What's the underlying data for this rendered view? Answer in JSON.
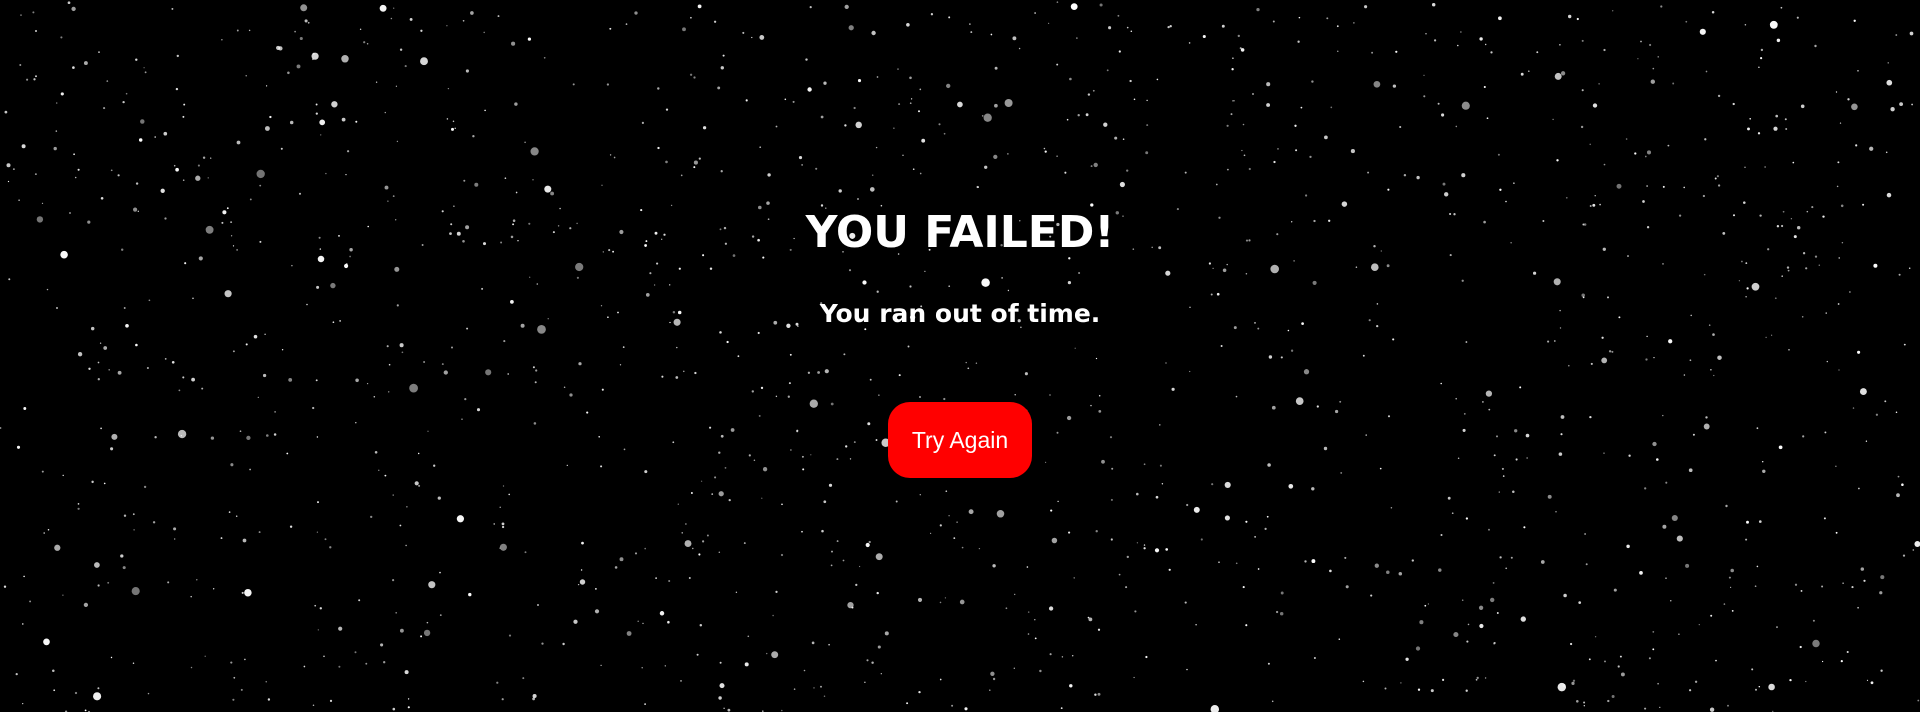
{
  "screen": {
    "title": "YOU FAILED!",
    "message": "You ran out of time.",
    "retry_label": "Try Again"
  },
  "colors": {
    "background": "#000000",
    "text": "#ffffff",
    "button": "#ff0000",
    "star": "#ffffff"
  }
}
